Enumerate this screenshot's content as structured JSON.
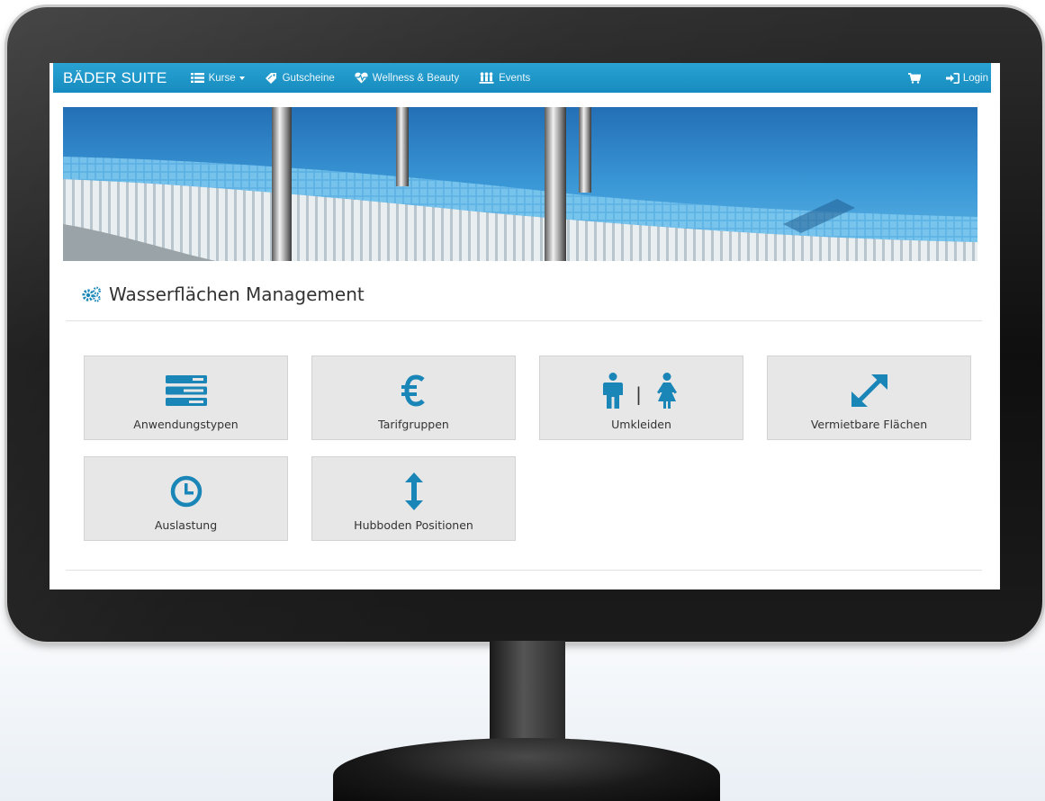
{
  "navbar": {
    "brand": "BÄDER SUITE",
    "items": [
      {
        "label": "Kurse",
        "icon": "list-icon"
      },
      {
        "label": "Gutscheine",
        "icon": "ticket-icon"
      },
      {
        "label": "Wellness & Beauty",
        "icon": "heartbeat-icon"
      },
      {
        "label": "Events",
        "icon": "people-icon"
      }
    ],
    "cart_icon": "cart-icon",
    "login_label": "Login"
  },
  "page": {
    "title": "Wasserflächen Management",
    "title_icon": "cogs-icon"
  },
  "tiles": [
    {
      "label": "Anwendungstypen",
      "icon": "server-icon"
    },
    {
      "label": "Tarifgruppen",
      "icon": "euro-icon"
    },
    {
      "label": "Umkleiden",
      "icon": "male-female-icon",
      "separator": "|"
    },
    {
      "label": "Vermietbare Flächen",
      "icon": "expand-icon"
    },
    {
      "label": "Auslastung",
      "icon": "clock-icon"
    },
    {
      "label": "Hubboden Positionen",
      "icon": "vertical-resize-icon"
    }
  ],
  "colors": {
    "navbar": "#1a94c8",
    "accent_icon": "#1a86b8",
    "tile_bg": "#e7e7e7"
  }
}
